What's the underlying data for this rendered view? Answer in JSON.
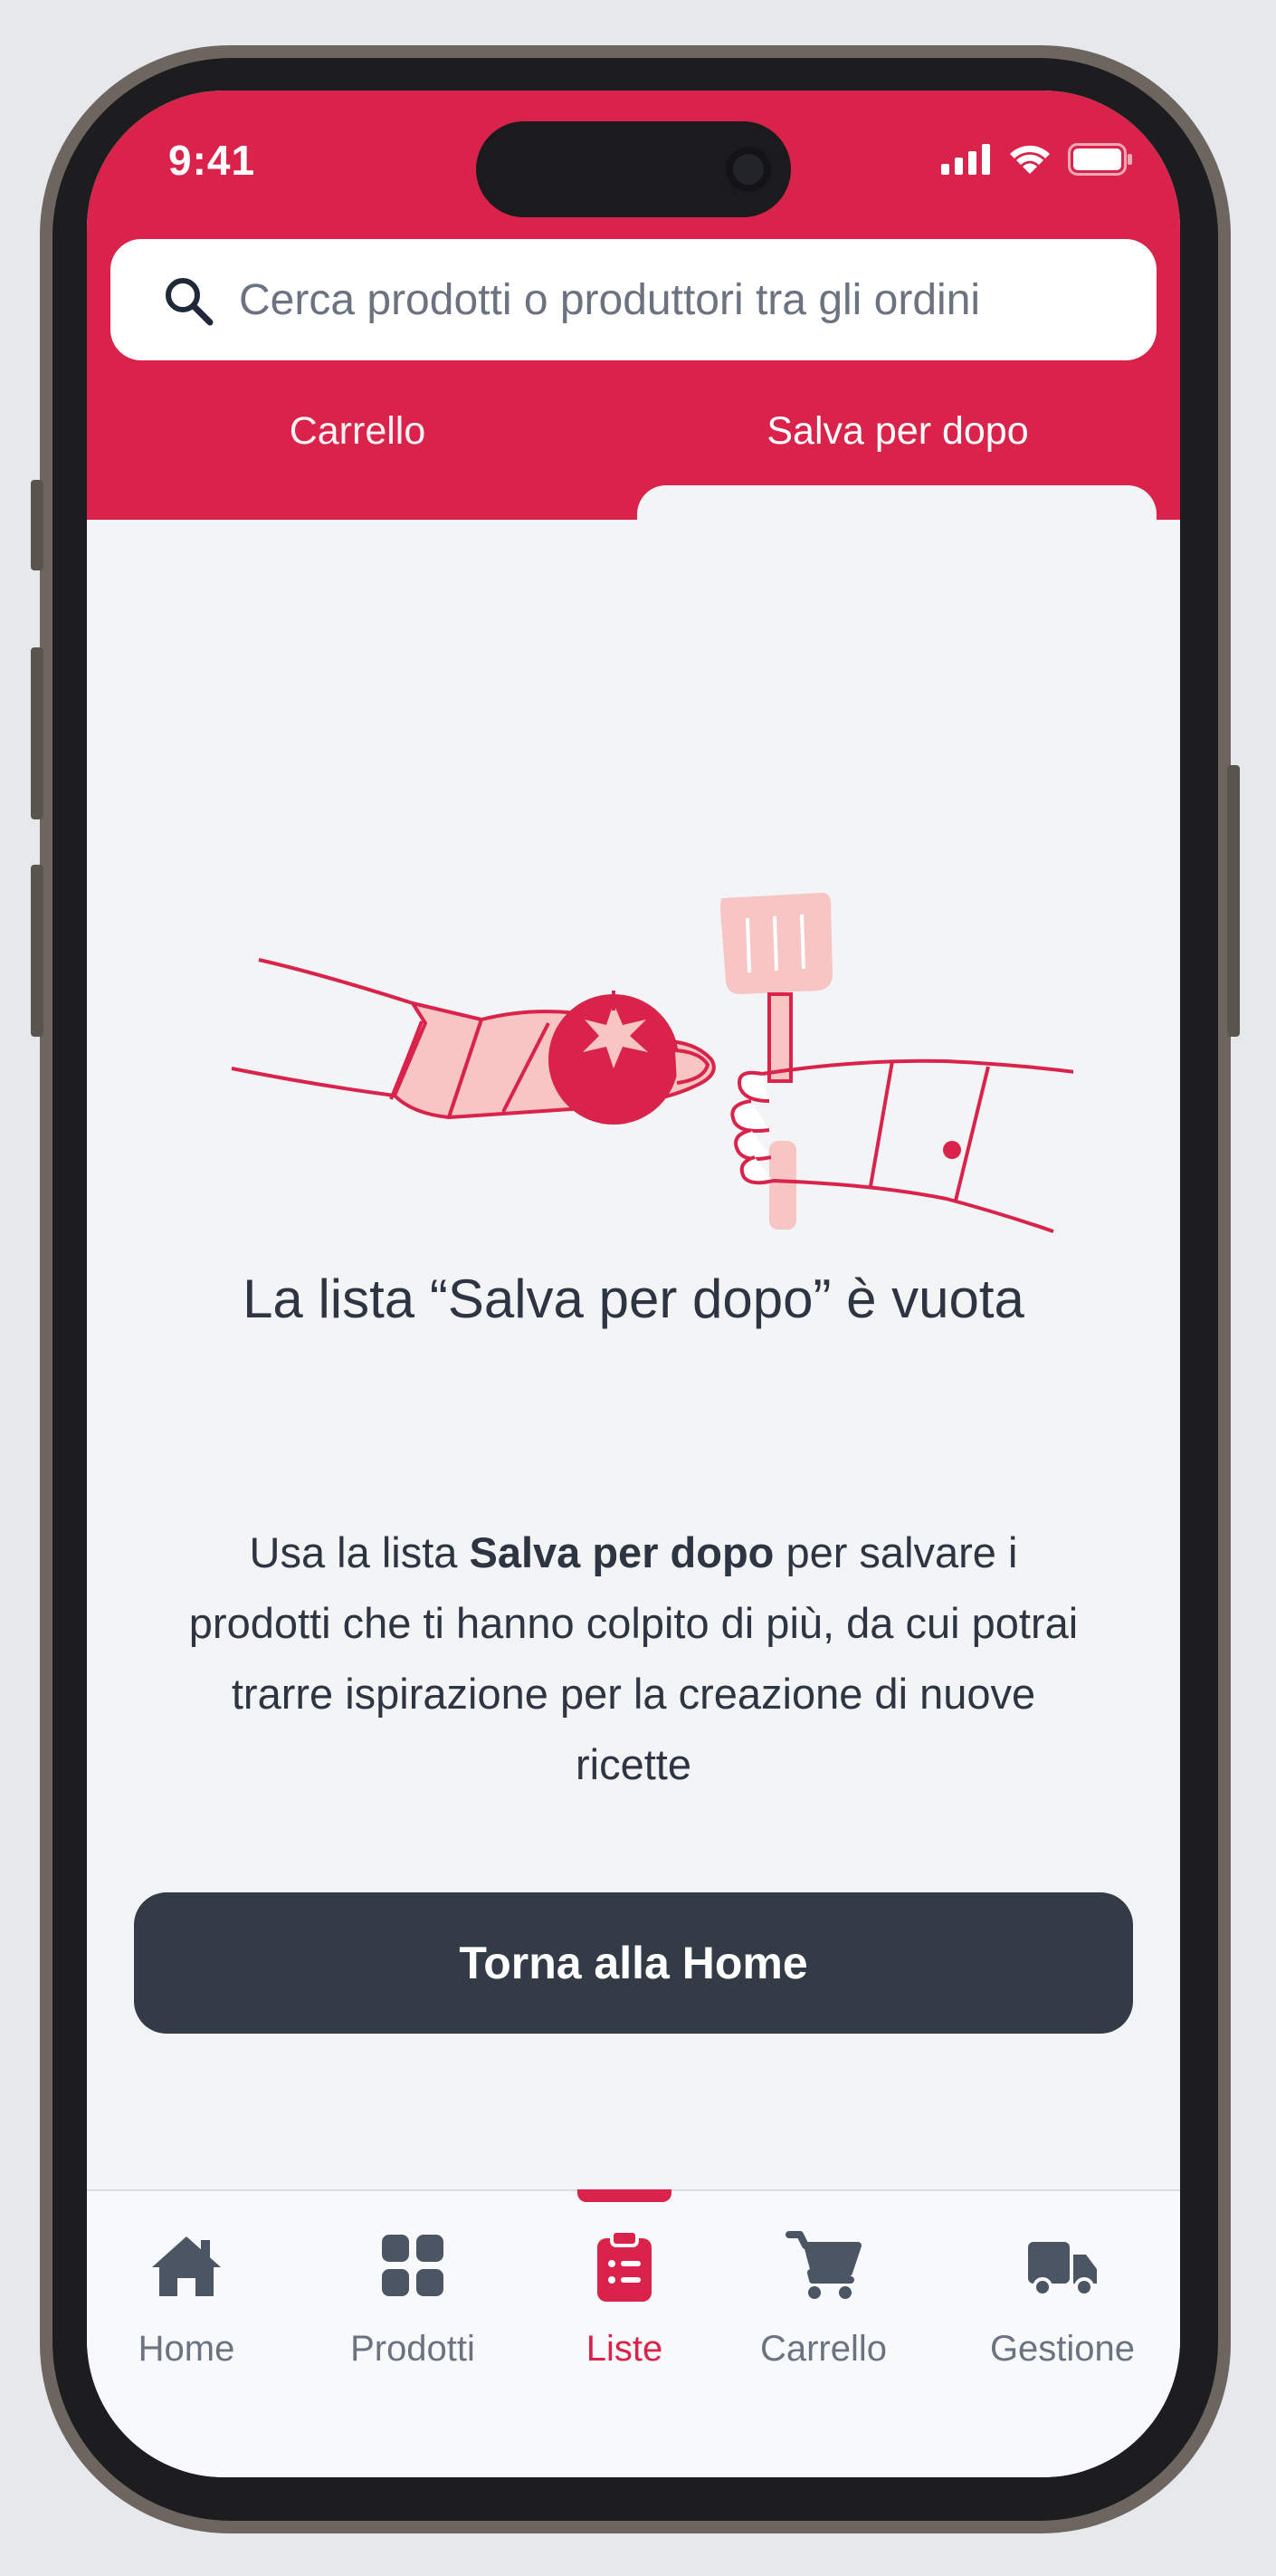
{
  "status_bar": {
    "time": "9:41"
  },
  "search": {
    "placeholder": "Cerca prodotti o produttori tra gli ordini"
  },
  "tabs": [
    {
      "label": "Carrello",
      "active": false
    },
    {
      "label": "Salva per dopo",
      "active": true
    }
  ],
  "empty_state": {
    "title": "La lista “Salva per dopo” è vuota",
    "description_prefix": "Usa la lista ",
    "description_bold": "Salva per dopo",
    "description_suffix": " per salvare i prodotti che ti hanno colpito di più, da cui potrai trarre ispirazione per la creazione di nuove ricette",
    "button_label": "Torna alla Home"
  },
  "bottom_nav": [
    {
      "label": "Home",
      "icon": "home-icon",
      "active": false
    },
    {
      "label": "Prodotti",
      "icon": "grid-icon",
      "active": false
    },
    {
      "label": "Liste",
      "icon": "clipboard-list-icon",
      "active": true
    },
    {
      "label": "Carrello",
      "icon": "cart-icon",
      "active": false
    },
    {
      "label": "Gestione",
      "icon": "truck-icon",
      "active": false
    }
  ],
  "colors": {
    "brand": "#d9234a",
    "button_dark": "#333b47",
    "text": "#2d3442",
    "muted": "#6b7280",
    "background": "#f3f4f6"
  }
}
